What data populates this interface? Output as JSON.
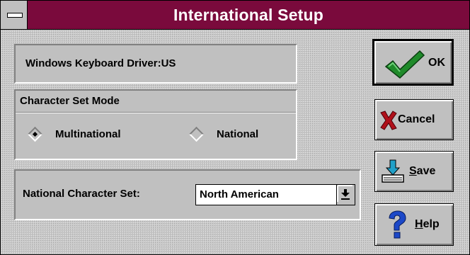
{
  "window": {
    "title": "International Setup"
  },
  "keyboard": {
    "label": "Windows Keyboard Driver:US"
  },
  "charset_mode": {
    "label": "Character Set Mode",
    "options": [
      {
        "label": "Multinational",
        "selected": true
      },
      {
        "label": "National",
        "selected": false
      }
    ]
  },
  "national_set": {
    "label": "National Character Set:",
    "value": "North American"
  },
  "buttons": {
    "ok": "OK",
    "cancel": "Cancel",
    "save": "Save",
    "help": "Help"
  },
  "icons": {
    "system_menu": "system-menu-icon",
    "ok": "checkmark-icon",
    "cancel": "x-mark-icon",
    "save": "save-disk-icon",
    "help": "question-mark-icon",
    "dropdown": "dropdown-arrow-icon"
  },
  "colors": {
    "titlebar": "#7a0a3c",
    "ok_check": "#1f8a2a",
    "cancel_x": "#b0101a",
    "help_question": "#1c48c8"
  }
}
